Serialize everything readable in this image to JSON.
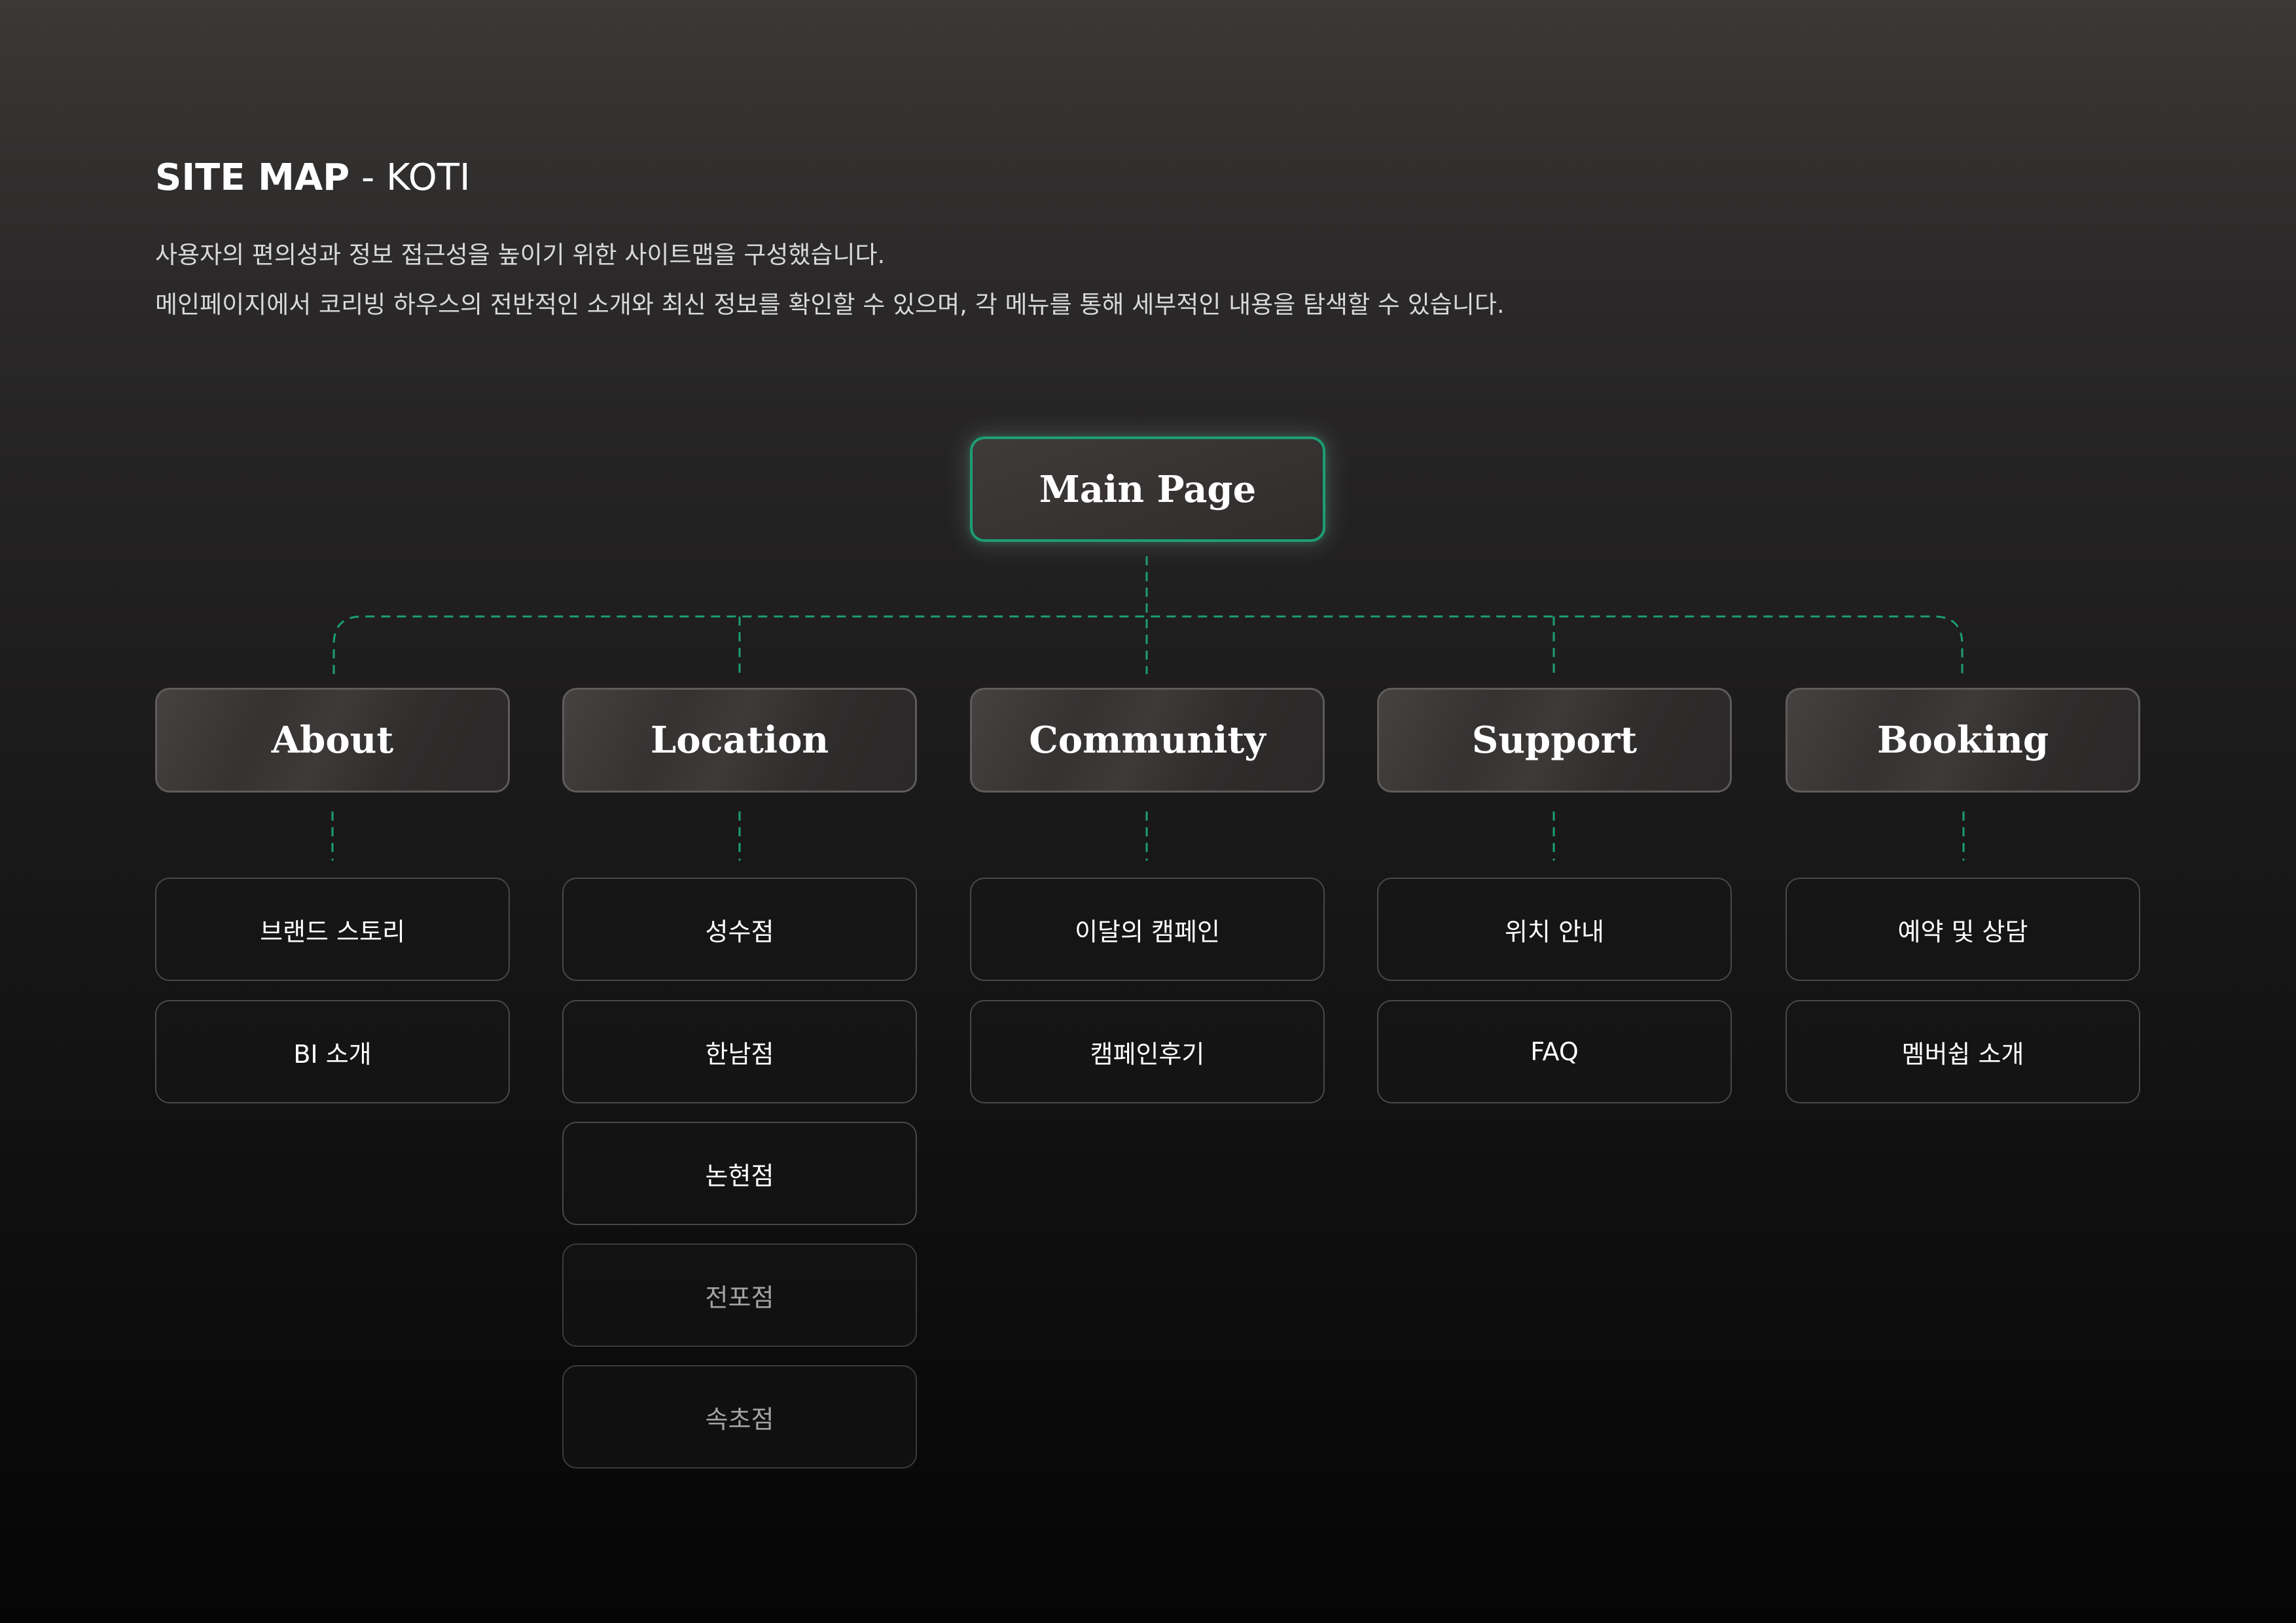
{
  "header": {
    "title_strong": "SITE MAP",
    "title_separator": " - ",
    "title_light": "KOTI",
    "description_line1": "사용자의 편의성과 정보 접근성을 높이기 위한 사이트맵을 구성했습니다.",
    "description_line2": "메인페이지에서 코리빙 하우스의 전반적인 소개와 최신 정보를 확인할 수 있으며, 각 메뉴를 통해 세부적인 내용을 탐색할 수 있습니다."
  },
  "sitemap": {
    "root": "Main Page",
    "categories": [
      {
        "label": "About",
        "children": [
          "브랜드 스토리",
          "BI 소개"
        ]
      },
      {
        "label": "Location",
        "children": [
          "성수점",
          "한남점",
          "논현점",
          "전포점",
          "속초점"
        ],
        "dimmed_children": [
          3,
          4
        ]
      },
      {
        "label": "Community",
        "children": [
          "이달의 캠페인",
          "캠페인후기"
        ]
      },
      {
        "label": "Support",
        "children": [
          "위치 안내",
          "FAQ"
        ]
      },
      {
        "label": "Booking",
        "children": [
          "예약 및 상담",
          "멤버쉽 소개"
        ]
      }
    ]
  },
  "colors": {
    "accent": "#1d9e76",
    "connector": "#1d9e76",
    "dimmed_text": "#a3a3a3"
  }
}
